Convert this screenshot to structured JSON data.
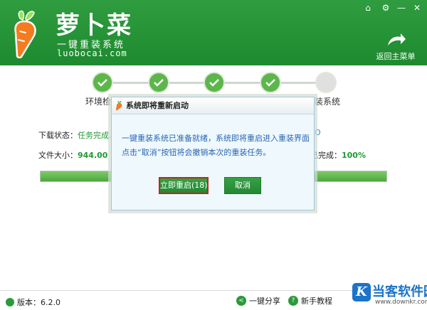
{
  "header": {
    "brand": "萝卜菜",
    "tagline": "一键重装系统",
    "url": "luobocai.com",
    "back_home_label": "返回主菜单"
  },
  "window_controls": [
    {
      "name": "home-icon",
      "glyph": "⌂"
    },
    {
      "name": "gear-icon",
      "glyph": "⚙"
    },
    {
      "name": "minimize-icon",
      "glyph": "—"
    },
    {
      "name": "close-icon",
      "glyph": "✕"
    }
  ],
  "steps": [
    {
      "label": "环境检测",
      "done": true
    },
    {
      "label": "",
      "done": true
    },
    {
      "label": "",
      "done": true
    },
    {
      "label": "",
      "done": true
    },
    {
      "label": "安装系统",
      "done": false
    }
  ],
  "status": {
    "download_label": "下载状态：",
    "download_value": "任务完成.",
    "right_link": "O",
    "size_label": "文件大小：",
    "size_value": "944.00 MB",
    "done_label": "已完成：",
    "done_value": "100%",
    "progress": 1.0
  },
  "dialog": {
    "title": "系统即将重新启动",
    "message_line1": "一键重装系统已准备就绪，系统即将重启进入重装界面",
    "message_line2": "点击“取消”按钮将会撤销本次的重装任务。",
    "restart_label": "立即重启(18)",
    "cancel_label": "取消"
  },
  "footer": {
    "version": "版本：6.2.0",
    "share": "一键分享",
    "tutorial": "新手教程"
  },
  "watermark": {
    "logo_letter": "K",
    "name": "当客软件园",
    "url": "www.downkr.com"
  },
  "colors": {
    "header_green": "#1e8a30",
    "step_green": "#5cb64a",
    "accent_blue": "#2b66b6",
    "highlight_red": "#c8221b"
  }
}
